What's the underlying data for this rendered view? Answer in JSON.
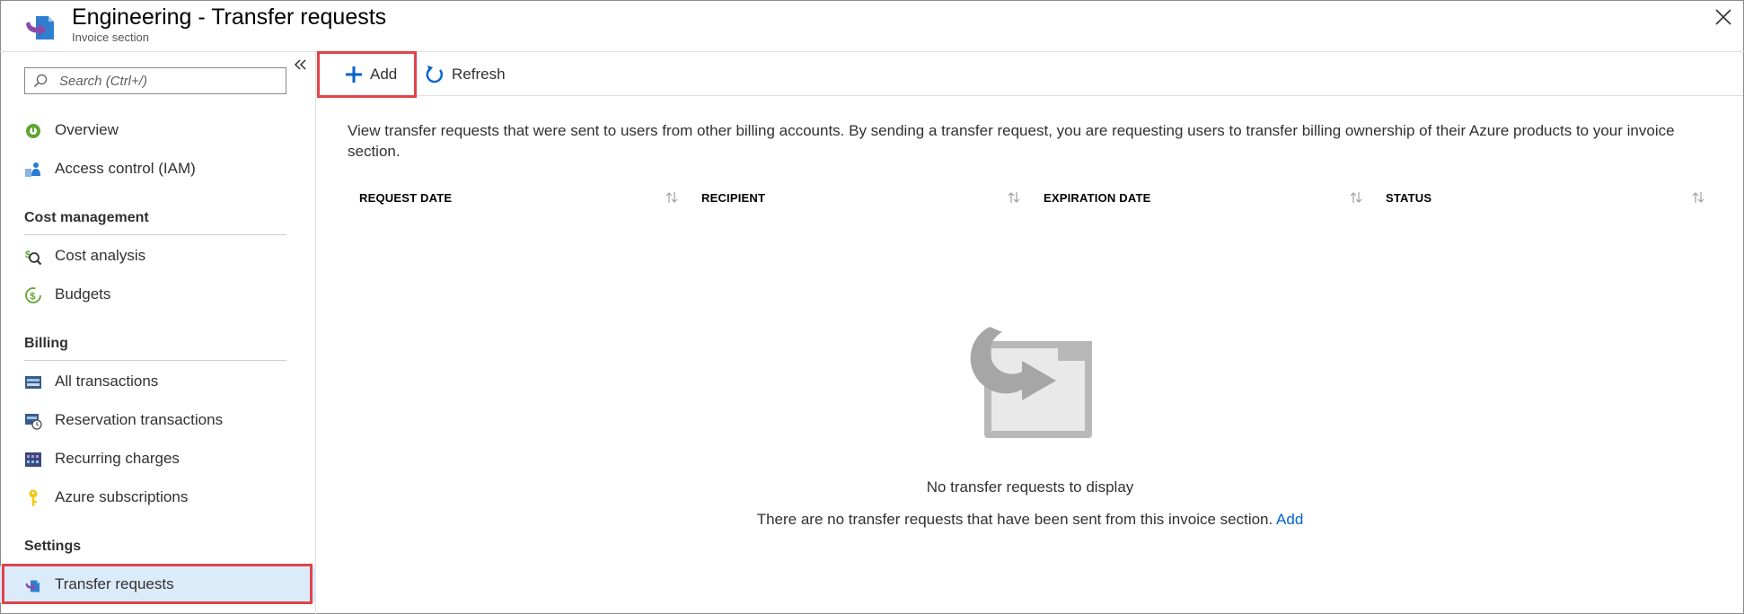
{
  "header": {
    "title": "Engineering - Transfer requests",
    "subtitle": "Invoice section"
  },
  "sidebar": {
    "search_placeholder": "Search (Ctrl+/)",
    "top_items": [
      {
        "label": "Overview",
        "icon": "overview-icon"
      },
      {
        "label": "Access control (IAM)",
        "icon": "iam-icon"
      }
    ],
    "sections": [
      {
        "heading": "Cost management",
        "items": [
          {
            "label": "Cost analysis",
            "icon": "cost-analysis-icon"
          },
          {
            "label": "Budgets",
            "icon": "budgets-icon"
          }
        ]
      },
      {
        "heading": "Billing",
        "items": [
          {
            "label": "All transactions",
            "icon": "transactions-icon"
          },
          {
            "label": "Reservation transactions",
            "icon": "reservation-icon"
          },
          {
            "label": "Recurring charges",
            "icon": "recurring-icon"
          },
          {
            "label": "Azure subscriptions",
            "icon": "key-icon"
          }
        ]
      },
      {
        "heading": "Settings",
        "items": [
          {
            "label": "Transfer requests",
            "icon": "transfer-icon",
            "selected": true
          }
        ]
      }
    ]
  },
  "toolbar": {
    "add_label": "Add",
    "refresh_label": "Refresh"
  },
  "main": {
    "description": "View transfer requests that were sent to users from other billing accounts. By sending a transfer request, you are requesting users to transfer billing ownership of their Azure products to your invoice section.",
    "columns": [
      "REQUEST DATE",
      "RECIPIENT",
      "EXPIRATION DATE",
      "STATUS"
    ],
    "empty_title": "No transfer requests to display",
    "empty_desc": "There are no transfer requests that have been sent from this invoice section.",
    "empty_link": "Add"
  },
  "colors": {
    "accent": "#0063c8",
    "highlight": "#e0444a",
    "selected_bg": "#dcebfa"
  }
}
